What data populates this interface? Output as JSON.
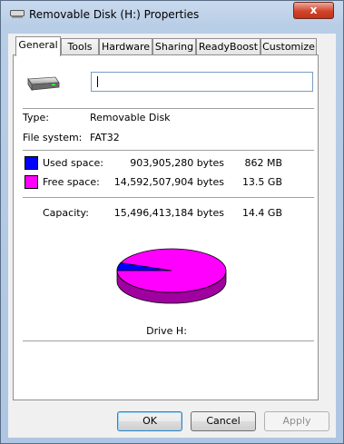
{
  "window": {
    "title": "Removable Disk (H:) Properties",
    "close_glyph": "x",
    "icon": "removable-disk-icon"
  },
  "tabs": [
    {
      "label": "General",
      "active": true
    },
    {
      "label": "Tools",
      "active": false
    },
    {
      "label": "Hardware",
      "active": false
    },
    {
      "label": "Sharing",
      "active": false
    },
    {
      "label": "ReadyBoost",
      "active": false
    },
    {
      "label": "Customize",
      "active": false
    }
  ],
  "general": {
    "volume_label_value": "",
    "type_label": "Type:",
    "type_value": "Removable Disk",
    "fs_label": "File system:",
    "fs_value": "FAT32",
    "used": {
      "label": "Used space:",
      "bytes": "903,905,280 bytes",
      "size": "862 MB",
      "color": "#0000ff"
    },
    "free": {
      "label": "Free space:",
      "bytes": "14,592,507,904 bytes",
      "size": "13.5 GB",
      "color": "#ff00ff"
    },
    "capacity": {
      "label": "Capacity:",
      "bytes": "15,496,413,184 bytes",
      "size": "14.4 GB"
    },
    "usage_fraction": 0.0583,
    "drive_label": "Drive H:"
  },
  "buttons": {
    "ok": "OK",
    "cancel": "Cancel",
    "apply": "Apply"
  }
}
